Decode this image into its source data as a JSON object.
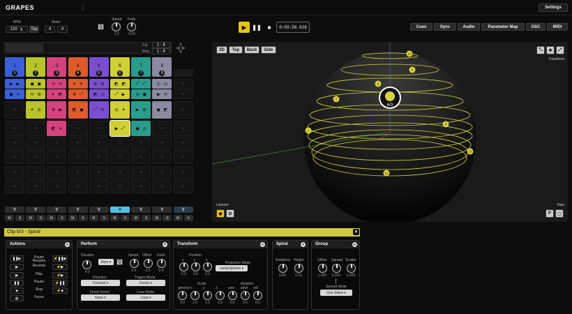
{
  "app": {
    "logo": "GRAPES",
    "settings_label": "Settings"
  },
  "header": {
    "bpm_label": "BPM",
    "bpm_value": "120",
    "tap_label": "Tap",
    "meter_label": "Meter",
    "meter_num": "4",
    "meter_den": "4",
    "speed_label": "Speed",
    "speed_value": "1.0",
    "fade_label": "Fade",
    "fade_value": "0.00",
    "q_label": "Q",
    "time": "0:09:50.829",
    "nav": [
      "Cues",
      "Sync",
      "Audio",
      "Parameter Map",
      "OSC",
      "MIDI"
    ]
  },
  "grid": {
    "col_label": "Col",
    "col_value": "1 - 8",
    "row_label": "Row",
    "row_value": "1 - 8",
    "tracks": [
      {
        "num": "1",
        "layer": "1",
        "color": "#3b5fd9"
      },
      {
        "num": "2",
        "layer": "2",
        "color": "#b8c42a"
      },
      {
        "num": "3",
        "layer": "3",
        "color": "#d6427e"
      },
      {
        "num": "4",
        "layer": "4",
        "color": "#e05a2a"
      },
      {
        "num": "5",
        "layer": "5",
        "color": "#7a4ed0"
      },
      {
        "num": "6",
        "layer": "6",
        "color": "#cfcf36"
      },
      {
        "num": "7",
        "layer": "7",
        "color": "#2a9c8c"
      },
      {
        "num": "8",
        "layer": "8",
        "color": "#8a8aa0"
      }
    ],
    "v_label": "V",
    "m_label": "M",
    "s_label": "S"
  },
  "viewport": {
    "views": [
      "3D",
      "Top",
      "Back",
      "Side"
    ],
    "transform_label": "Transform",
    "listener_label": "Listener",
    "view_label": "View",
    "selected_label": "6/3",
    "p_label": "P",
    "markers": [
      "12",
      "4",
      "3",
      "2",
      "6",
      "1",
      "10",
      "11",
      "5"
    ]
  },
  "clip": {
    "title": "Clip 6/3 - Spiral",
    "close": "×"
  },
  "actions": {
    "title": "Actions",
    "items": [
      "Pause Resume",
      "Resume",
      "Play",
      "Pause",
      "Stop",
      "Focus"
    ]
  },
  "perform": {
    "title": "Perform",
    "duration_label": "Duration",
    "duration_value": "4.0",
    "bars": "Bars",
    "q": "Q",
    "speed_label": "Speed",
    "speed_value": "0.0",
    "offset_label": "Offset",
    "offset_value": "0.0",
    "fade_label": "Fade",
    "fade_value": "0.0",
    "direction_label": "Direction",
    "direction_value": "Forward",
    "trigger_label": "Trigger Mode",
    "trigger_value": "Freely",
    "finish_label": "Finish Action",
    "finish_value": "None",
    "loop_label": "Loop Mode",
    "loop_value": "Loop"
  },
  "transform": {
    "title": "Transform",
    "position_label": "Position",
    "x": "x",
    "y": "y",
    "z": "z",
    "pos_values": [
      "0.0",
      "0.0",
      "0.0"
    ],
    "projection_label": "Projection Mode",
    "projection_value": "centerSphere",
    "scale_label": "Scale",
    "rotation_label": "Rotation",
    "general": "general",
    "yaw": "yaw",
    "pitch": "pitch",
    "roll": "roll",
    "scale_values": [
      "0.0",
      "1.0",
      "1.0",
      "1.0"
    ],
    "rot_values": [
      "0.0",
      "0.0",
      "0.0"
    ]
  },
  "spiral": {
    "title": "Spiral",
    "rotations_label": "Rotations",
    "rotations_value": "6.80",
    "height_label": "Height",
    "height_value": "0.10"
  },
  "group": {
    "title": "Group",
    "offset_label": "Offset",
    "offset_value": "1.000",
    "spread_label": "Spread",
    "spread_value": "0.000",
    "scatter_label": "Scatter",
    "scatter_value": "0.000",
    "spread_mode_label": "Spread Mode",
    "spread_mode_value": "One Sided"
  }
}
